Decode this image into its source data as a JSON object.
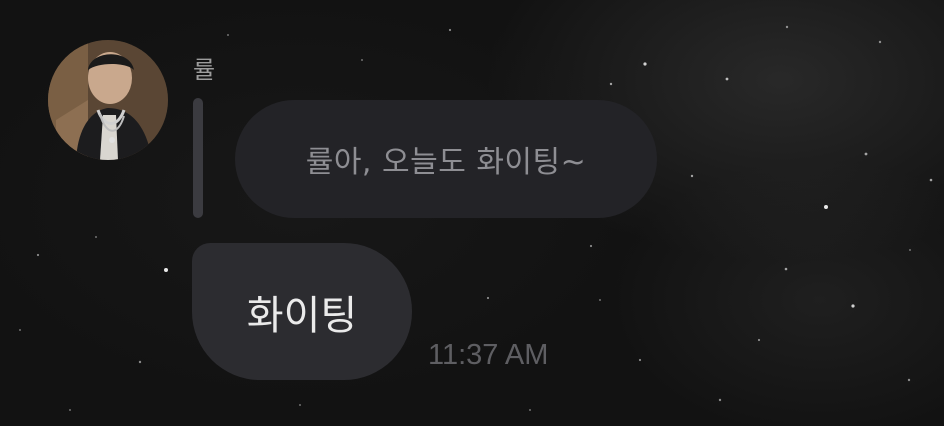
{
  "chat": {
    "sender_name": "률",
    "quoted_message": "률아, 오늘도 화이팅~",
    "message": "화이팅",
    "timestamp": "11:37 AM"
  },
  "colors": {
    "background": "#121212",
    "quoted_bubble": "#232327",
    "message_bubble": "#2c2c30",
    "reply_bar": "#3b3b40",
    "sender_name": "#9d9d9d",
    "quoted_text": "#8e8e93",
    "message_text": "#eaeaea",
    "timestamp": "#5e5e62"
  },
  "avatar": {
    "icon": "profile-photo"
  }
}
